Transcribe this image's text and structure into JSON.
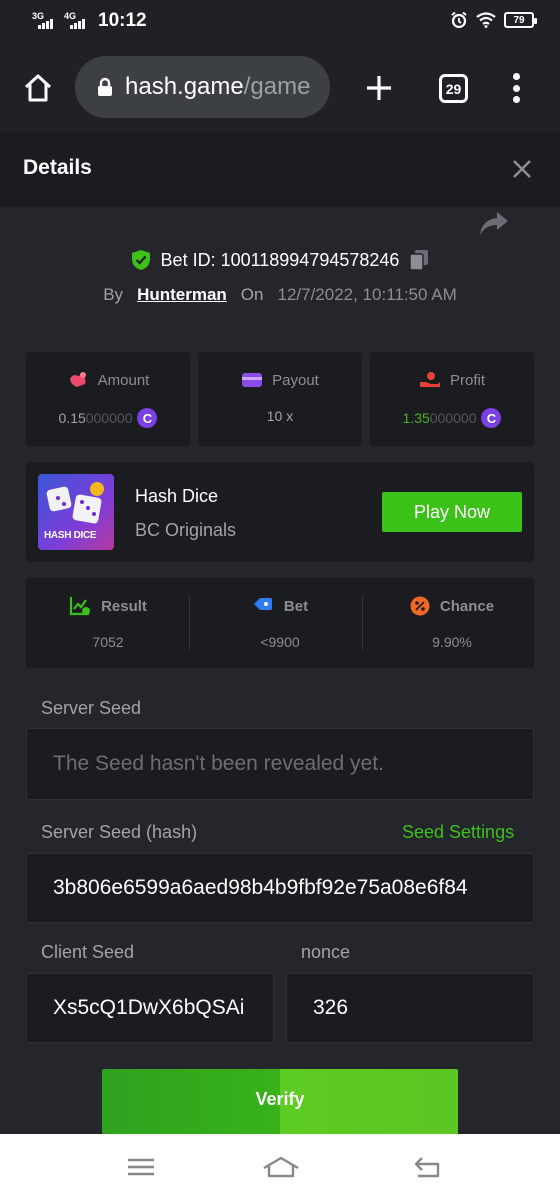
{
  "status_bar": {
    "network1": "3G",
    "network2": "4G",
    "time": "10:12",
    "battery": "79"
  },
  "browser": {
    "url_main": "hash.game",
    "url_rest": "/game",
    "tab_count": "29"
  },
  "details": {
    "title": "Details"
  },
  "bet": {
    "id_label": "Bet ID: 100118994794578246",
    "by_label": "By",
    "user": "Hunterman",
    "on_label": "On",
    "date": "12/7/2022, 10:11:50 AM"
  },
  "stats": {
    "amount_label": "Amount",
    "amount_main": "0.15",
    "amount_faint": "000000",
    "payout_label": "Payout",
    "payout_value": "10 x",
    "profit_label": "Profit",
    "profit_main": "1.35",
    "profit_faint": "000000",
    "coin_symbol": "C"
  },
  "game": {
    "thumb_label": "HASH DICE",
    "name": "Hash Dice",
    "provider": "BC Originals",
    "play_label": "Play Now"
  },
  "result": {
    "result_label": "Result",
    "result_value": "7052",
    "bet_label": "Bet",
    "bet_value": "<9900",
    "chance_label": "Chance",
    "chance_value": "9.90%"
  },
  "seeds": {
    "server_seed_label": "Server Seed",
    "server_seed_placeholder": "The Seed hasn't been revealed yet.",
    "server_hash_label": "Server Seed (hash)",
    "seed_settings_label": "Seed Settings",
    "server_hash_value": "3b806e6599a6aed98b4b9fbf92e75a08e6f84",
    "client_seed_label": "Client Seed",
    "client_seed_value": "Xs5cQ1DwX6bQSAi",
    "nonce_label": "nonce",
    "nonce_value": "326"
  },
  "verify_label": "Verify",
  "colors": {
    "accent_green": "#3bc117",
    "coin_purple": "#7b3fe4",
    "background": "#24262b",
    "card": "#1b1c20"
  }
}
